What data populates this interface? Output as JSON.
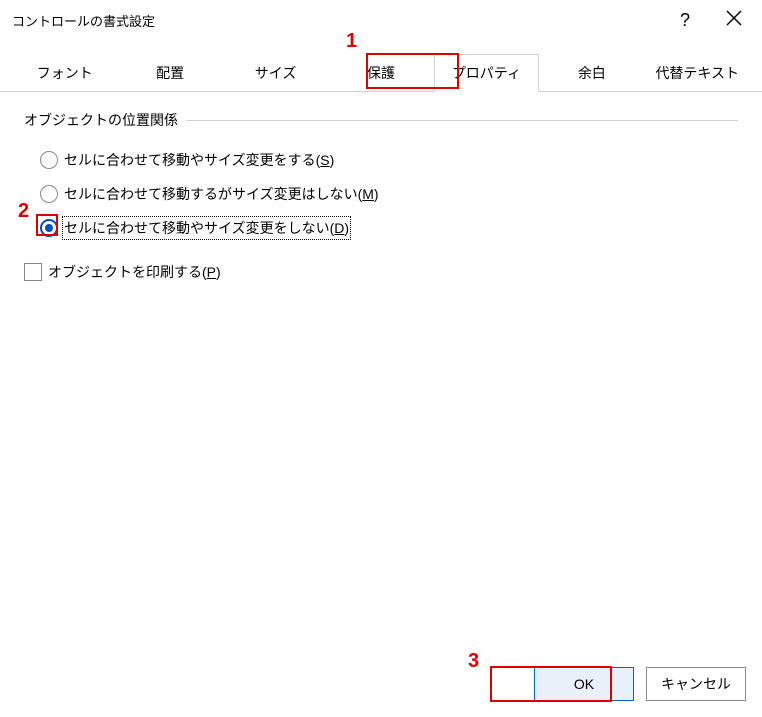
{
  "titlebar": {
    "title": "コントロールの書式設定",
    "help": "?",
    "close": "×"
  },
  "tabs": {
    "font": "フォント",
    "align": "配置",
    "size": "サイズ",
    "protect": "保護",
    "properties": "プロパティ",
    "margin": "余白",
    "alttext": "代替テキスト"
  },
  "group": {
    "position_label": "オブジェクトの位置関係"
  },
  "radios": {
    "move_size": {
      "text": "セルに合わせて移動やサイズ変更をする(",
      "mnemonic": "S",
      "suffix": ")"
    },
    "move_only": {
      "text": "セルに合わせて移動するがサイズ変更はしない(",
      "mnemonic": "M",
      "suffix": ")"
    },
    "no_move": {
      "text": "セルに合わせて移動やサイズ変更をしない(",
      "mnemonic": "D",
      "suffix": ")"
    }
  },
  "checkbox": {
    "print": {
      "text": "オブジェクトを印刷する(",
      "mnemonic": "P",
      "suffix": ")"
    }
  },
  "buttons": {
    "ok": "OK",
    "cancel": "キャンセル"
  },
  "annotations": {
    "n1": "1",
    "n2": "2",
    "n3": "3"
  }
}
